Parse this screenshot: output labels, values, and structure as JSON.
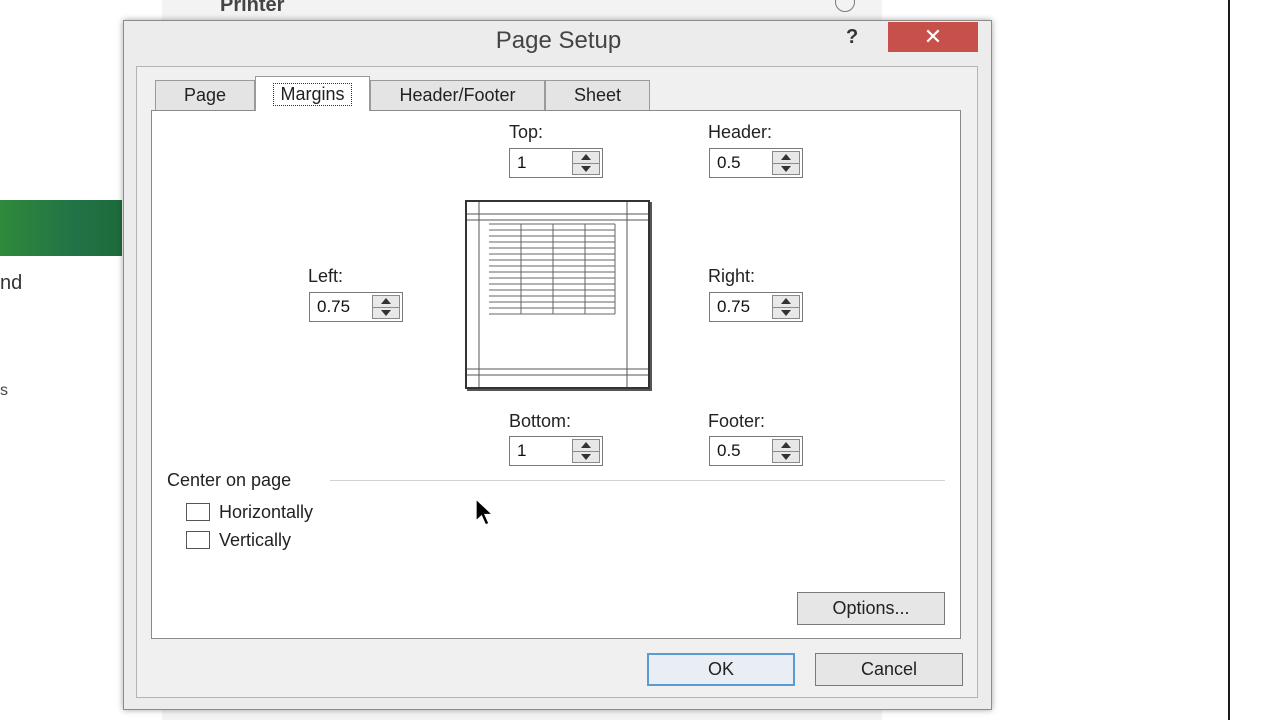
{
  "background": {
    "printer_label": "Printer",
    "left_text_1": "nd",
    "left_text_2": "s"
  },
  "dialog": {
    "title": "Page Setup",
    "help_label": "?",
    "close_label": "✕",
    "tabs": [
      {
        "label": "Page"
      },
      {
        "label": "Margins"
      },
      {
        "label": "Header/Footer"
      },
      {
        "label": "Sheet"
      }
    ],
    "active_tab": "Margins",
    "fields": {
      "top": {
        "label": "Top:",
        "value": "1"
      },
      "header": {
        "label": "Header:",
        "value": "0.5"
      },
      "left": {
        "label": "Left:",
        "value": "0.75"
      },
      "right": {
        "label": "Right:",
        "value": "0.75"
      },
      "bottom": {
        "label": "Bottom:",
        "value": "1"
      },
      "footer": {
        "label": "Footer:",
        "value": "0.5"
      }
    },
    "center_on_page": {
      "label": "Center on page",
      "horizontally": {
        "label": "Horizontally",
        "checked": false
      },
      "vertically": {
        "label": "Vertically",
        "checked": false
      }
    },
    "buttons": {
      "options": "Options...",
      "ok": "OK",
      "cancel": "Cancel"
    }
  },
  "colors": {
    "close_button": "#c7504b",
    "excel_green": "#217346",
    "ok_focus_border": "#5b9bd5"
  },
  "icons": [
    "info-icon",
    "help-icon",
    "close-icon",
    "spin-up-icon",
    "spin-down-icon",
    "mouse-pointer-icon"
  ]
}
